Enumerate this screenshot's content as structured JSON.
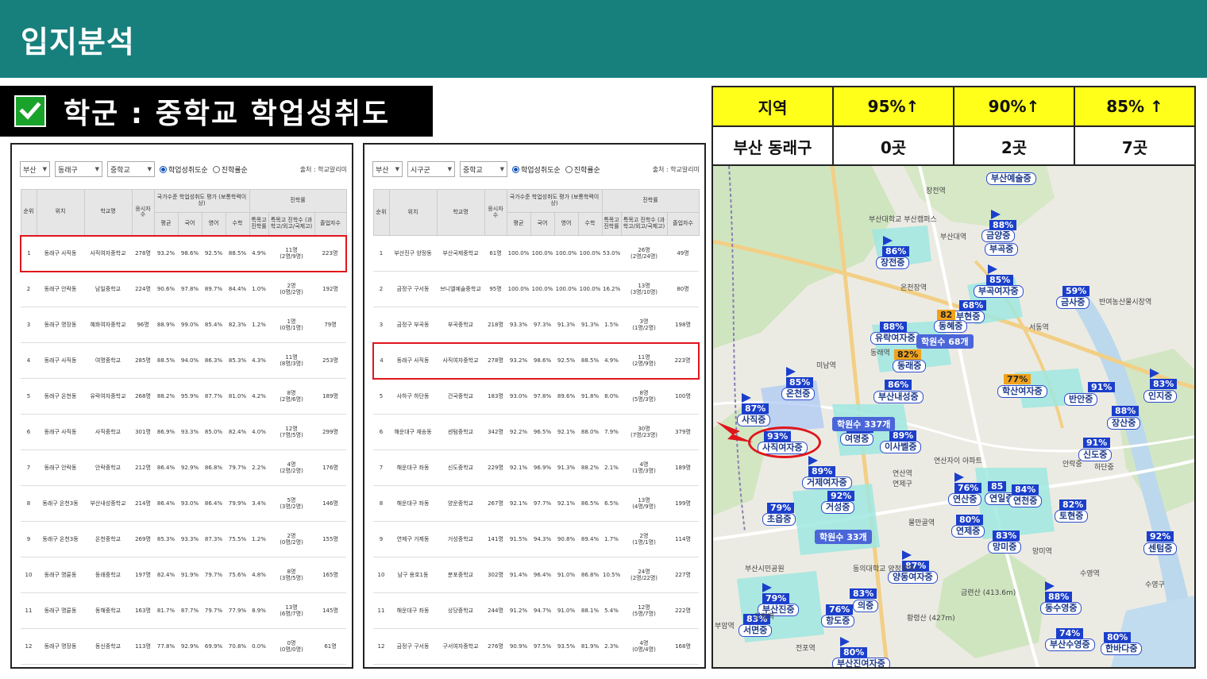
{
  "header": {
    "title": "입지분석"
  },
  "section": {
    "title": "학군 : 중학교 학업성취도"
  },
  "panel_left": {
    "filters": {
      "region": "부산",
      "district": "동래구",
      "school_type": "중학교"
    },
    "radio": {
      "achievement": "학업성취도순",
      "advancement": "진학률순"
    },
    "source": "출처 : 학교알리미",
    "headers": {
      "rank": "순위",
      "location": "위치",
      "school": "학교명",
      "test_takers": "응시자수",
      "national": "국가수준 학업성취도 평가 (보통학력이상)",
      "advancement": "진학률",
      "avg": "평균",
      "korean": "국어",
      "english": "영어",
      "math": "수학",
      "special": "특목고 진학률",
      "special_count": "특목고 진학수 (과학고/외고/국제고)",
      "graduates": "졸업자수"
    },
    "rows": [
      {
        "rank": "1",
        "loc": "동래구 사직동",
        "school": "사직여자중학교",
        "n": "278명",
        "avg": "93.2%",
        "kor": "98.6%",
        "eng": "92.5%",
        "math": "88.5%",
        "sp": "4.9%",
        "spc1": "11명",
        "spc2": "(2명/9명)",
        "grad": "223명",
        "hl": true
      },
      {
        "rank": "2",
        "loc": "동래구 안락동",
        "school": "남일중학교",
        "n": "224명",
        "avg": "90.6%",
        "kor": "97.8%",
        "eng": "89.7%",
        "math": "84.4%",
        "sp": "1.0%",
        "spc1": "2명",
        "spc2": "(0명/2명)",
        "grad": "192명",
        "hl": false
      },
      {
        "rank": "3",
        "loc": "동래구 명장동",
        "school": "혜화여자중학교",
        "n": "96명",
        "avg": "88.9%",
        "kor": "99.0%",
        "eng": "85.4%",
        "math": "82.3%",
        "sp": "1.2%",
        "spc1": "1명",
        "spc2": "(0명/1명)",
        "grad": "79명",
        "hl": false
      },
      {
        "rank": "4",
        "loc": "동래구 사직동",
        "school": "여명중학교",
        "n": "285명",
        "avg": "88.5%",
        "kor": "94.0%",
        "eng": "86.3%",
        "math": "85.3%",
        "sp": "4.3%",
        "spc1": "11명",
        "spc2": "(8명/3명)",
        "grad": "253명",
        "hl": false
      },
      {
        "rank": "5",
        "loc": "동래구 온천동",
        "school": "유락여자중학교",
        "n": "268명",
        "avg": "88.2%",
        "kor": "95.9%",
        "eng": "87.7%",
        "math": "81.0%",
        "sp": "4.2%",
        "spc1": "8명",
        "spc2": "(2명/6명)",
        "grad": "189명",
        "hl": false
      },
      {
        "rank": "6",
        "loc": "동래구 사직동",
        "school": "사직중학교",
        "n": "301명",
        "avg": "86.9%",
        "kor": "93.3%",
        "eng": "85.0%",
        "math": "82.4%",
        "sp": "4.0%",
        "spc1": "12명",
        "spc2": "(7명/5명)",
        "grad": "299명",
        "hl": false
      },
      {
        "rank": "7",
        "loc": "동래구 안락동",
        "school": "안락중학교",
        "n": "212명",
        "avg": "86.4%",
        "kor": "92.9%",
        "eng": "86.8%",
        "math": "79.7%",
        "sp": "2.2%",
        "spc1": "4명",
        "spc2": "(2명/2명)",
        "grad": "176명",
        "hl": false
      },
      {
        "rank": "8",
        "loc": "동래구 온천3동",
        "school": "부산내성중학교",
        "n": "214명",
        "avg": "86.4%",
        "kor": "93.0%",
        "eng": "86.4%",
        "math": "79.9%",
        "sp": "3.4%",
        "spc1": "5명",
        "spc2": "(3명/2명)",
        "grad": "146명",
        "hl": false
      },
      {
        "rank": "9",
        "loc": "동래구 온천3동",
        "school": "온천중학교",
        "n": "269명",
        "avg": "85.3%",
        "kor": "93.3%",
        "eng": "87.3%",
        "math": "75.5%",
        "sp": "1.2%",
        "spc1": "2명",
        "spc2": "(0명/2명)",
        "grad": "155명",
        "hl": false
      },
      {
        "rank": "10",
        "loc": "동래구 명륜동",
        "school": "동래중학교",
        "n": "197명",
        "avg": "82.4%",
        "kor": "91.9%",
        "eng": "79.7%",
        "math": "75.6%",
        "sp": "4.8%",
        "spc1": "8명",
        "spc2": "(3명/5명)",
        "grad": "165명",
        "hl": false
      },
      {
        "rank": "11",
        "loc": "동래구 명륜동",
        "school": "동해중학교",
        "n": "163명",
        "avg": "81.7%",
        "kor": "87.7%",
        "eng": "79.7%",
        "math": "77.9%",
        "sp": "8.9%",
        "spc1": "13명",
        "spc2": "(6명/7명)",
        "grad": "145명",
        "hl": false
      },
      {
        "rank": "12",
        "loc": "동래구 명장동",
        "school": "동신중학교",
        "n": "113명",
        "avg": "77.8%",
        "kor": "92.9%",
        "eng": "69.9%",
        "math": "70.8%",
        "sp": "0.0%",
        "spc1": "0명",
        "spc2": "(0명/0명)",
        "grad": "61명",
        "hl": false
      }
    ]
  },
  "panel_right": {
    "filters": {
      "region": "부산",
      "district": "시구군",
      "school_type": "중학교"
    },
    "radio": {
      "achievement": "학업성취도순",
      "advancement": "진학률순"
    },
    "source": "출처 : 학교알리미",
    "headers": {
      "rank": "순위",
      "location": "위치",
      "school": "학교명",
      "test_takers": "응시자수",
      "national": "국가수준 학업성취도 평가 (보통학력이상)",
      "advancement": "진학률",
      "avg": "평균",
      "korean": "국어",
      "english": "영어",
      "math": "수학",
      "special": "특목고 진학률",
      "special_count": "특목고 진학수 (과학고/외고/국제고)",
      "graduates": "졸업자수"
    },
    "rows": [
      {
        "rank": "1",
        "loc": "부산진구 양정동",
        "school": "부산국제중학교",
        "n": "61명",
        "avg": "100.0%",
        "kor": "100.0%",
        "eng": "100.0%",
        "math": "100.0%",
        "sp": "53.0%",
        "spc1": "26명",
        "spc2": "(2명/24명)",
        "grad": "49명",
        "hl": false
      },
      {
        "rank": "2",
        "loc": "금정구 구서동",
        "school": "브니엘예술중학교",
        "n": "95명",
        "avg": "100.0%",
        "kor": "100.0%",
        "eng": "100.0%",
        "math": "100.0%",
        "sp": "16.2%",
        "spc1": "13명",
        "spc2": "(3명/10명)",
        "grad": "80명",
        "hl": false
      },
      {
        "rank": "3",
        "loc": "금정구 부곡동",
        "school": "부곡중학교",
        "n": "218명",
        "avg": "93.3%",
        "kor": "97.3%",
        "eng": "91.3%",
        "math": "91.3%",
        "sp": "1.5%",
        "spc1": "3명",
        "spc2": "(1명/2명)",
        "grad": "198명",
        "hl": false
      },
      {
        "rank": "4",
        "loc": "동래구 사직동",
        "school": "사직여자중학교",
        "n": "278명",
        "avg": "93.2%",
        "kor": "98.6%",
        "eng": "92.5%",
        "math": "88.5%",
        "sp": "4.9%",
        "spc1": "11명",
        "spc2": "(2명/9명)",
        "grad": "223명",
        "hl": true
      },
      {
        "rank": "5",
        "loc": "사하구 하단동",
        "school": "건국중학교",
        "n": "183명",
        "avg": "93.0%",
        "kor": "97.8%",
        "eng": "89.6%",
        "math": "91.8%",
        "sp": "8.0%",
        "spc1": "8명",
        "spc2": "(5명/3명)",
        "grad": "100명",
        "hl": false
      },
      {
        "rank": "6",
        "loc": "해운대구 재송동",
        "school": "센텀중학교",
        "n": "342명",
        "avg": "92.2%",
        "kor": "96.5%",
        "eng": "92.1%",
        "math": "88.0%",
        "sp": "7.9%",
        "spc1": "30명",
        "spc2": "(7명/23명)",
        "grad": "379명",
        "hl": false
      },
      {
        "rank": "7",
        "loc": "해운대구 좌동",
        "school": "신도중학교",
        "n": "229명",
        "avg": "92.1%",
        "kor": "96.9%",
        "eng": "91.3%",
        "math": "88.2%",
        "sp": "2.1%",
        "spc1": "4명",
        "spc2": "(1명/3명)",
        "grad": "189명",
        "hl": false
      },
      {
        "rank": "8",
        "loc": "해운대구 좌동",
        "school": "양운중학교",
        "n": "267명",
        "avg": "92.1%",
        "kor": "97.7%",
        "eng": "92.1%",
        "math": "86.5%",
        "sp": "6.5%",
        "spc1": "13명",
        "spc2": "(4명/9명)",
        "grad": "199명",
        "hl": false
      },
      {
        "rank": "9",
        "loc": "연제구 거제동",
        "school": "거성중학교",
        "n": "141명",
        "avg": "91.5%",
        "kor": "94.3%",
        "eng": "90.8%",
        "math": "89.4%",
        "sp": "1.7%",
        "spc1": "2명",
        "spc2": "(1명/1명)",
        "grad": "114명",
        "hl": false
      },
      {
        "rank": "10",
        "loc": "남구 용호1동",
        "school": "분포중학교",
        "n": "302명",
        "avg": "91.4%",
        "kor": "96.4%",
        "eng": "91.0%",
        "math": "86.8%",
        "sp": "10.5%",
        "spc1": "24명",
        "spc2": "(2명/22명)",
        "grad": "227명",
        "hl": false
      },
      {
        "rank": "11",
        "loc": "해운대구 좌동",
        "school": "상당중학교",
        "n": "244명",
        "avg": "91.2%",
        "kor": "94.7%",
        "eng": "91.0%",
        "math": "88.1%",
        "sp": "5.4%",
        "spc1": "12명",
        "spc2": "(5명/7명)",
        "grad": "222명",
        "hl": false
      },
      {
        "rank": "12",
        "loc": "금정구 구서동",
        "school": "구서여자중학교",
        "n": "276명",
        "avg": "90.9%",
        "kor": "97.5%",
        "eng": "93.5%",
        "math": "81.9%",
        "sp": "2.3%",
        "spc1": "4명",
        "spc2": "(0명/4명)",
        "grad": "168명",
        "hl": false
      }
    ]
  },
  "summary": {
    "header_region": "지역",
    "h95": "95%↑",
    "h90": "90%↑",
    "h85": "85% ↑",
    "region": "부산 동래구",
    "v95": "0곳",
    "v90": "2곳",
    "v85": "7곳"
  },
  "map": {
    "pins": [
      {
        "pct": "86%",
        "name": "장전중"
      },
      {
        "pct": "88%",
        "name": "금양중"
      },
      {
        "pct": "",
        "name": "부곡중"
      },
      {
        "pct": "85%",
        "name": "부곡여자중"
      },
      {
        "pct": "59%",
        "name": "금사중"
      },
      {
        "pct": "68%",
        "name": "부현중"
      },
      {
        "pct": "82",
        "name": "동혜중"
      },
      {
        "pct": "88%",
        "name": "유락여자중"
      },
      {
        "pct": "82%",
        "name": "동래중"
      },
      {
        "pct": "85%",
        "name": "온천중"
      },
      {
        "pct": "86%",
        "name": "부산내성중"
      },
      {
        "pct": "77%",
        "name": "학산여자중"
      },
      {
        "pct": "87%",
        "name": "사직중"
      },
      {
        "pct": "93%",
        "name": "사직여자중"
      },
      {
        "pct": "89%",
        "name": "여명중"
      },
      {
        "pct": "89%",
        "name": "이사벨중"
      },
      {
        "pct": "89%",
        "name": "거제여자중"
      },
      {
        "pct": "92%",
        "name": "거성중"
      },
      {
        "pct": "79%",
        "name": "초읍중"
      },
      {
        "pct": "76%",
        "name": "연산중"
      },
      {
        "pct": "85",
        "name": "연일중"
      },
      {
        "pct": "84%",
        "name": "연천중"
      },
      {
        "pct": "80%",
        "name": "연제중"
      },
      {
        "pct": "83%",
        "name": "망미중"
      },
      {
        "pct": "82%",
        "name": "토현중"
      },
      {
        "pct": "91%",
        "name": "반안중"
      },
      {
        "pct": "83%",
        "name": "인지중"
      },
      {
        "pct": "88%",
        "name": "장산중"
      },
      {
        "pct": "91%",
        "name": "신도중"
      },
      {
        "pct": "92%",
        "name": "센텀중"
      },
      {
        "pct": "87%",
        "name": "양동여자중"
      },
      {
        "pct": "83%",
        "name": "의중"
      },
      {
        "pct": "76%",
        "name": "항도중"
      },
      {
        "pct": "79%",
        "name": "부산진중"
      },
      {
        "pct": "83%",
        "name": "서면중"
      },
      {
        "pct": "88%",
        "name": "동수영중"
      },
      {
        "pct": "74%",
        "name": "부산수영중"
      },
      {
        "pct": "80%",
        "name": "한바다중"
      },
      {
        "pct": "80%",
        "name": "부산진여자중"
      },
      {
        "pct": "",
        "name": "부산예술중"
      }
    ],
    "places": [
      "장전역",
      "부산대학교 부산캠퍼스",
      "부산대역",
      "온천장역",
      "서동역",
      "미남역",
      "동래역",
      "연산자이 아파트",
      "연산역",
      "연제구",
      "금련산 (413.6m)",
      "황령산 (427m)",
      "수영역",
      "부산시민공원",
      "동의대학교 양정캠퍼스",
      "물만골역",
      "망미역",
      "전포역",
      "부암역",
      "수영구",
      "반여농산물시장역",
      "양정역",
      "안락중",
      "하단중"
    ],
    "counts": [
      "학원수 68개",
      "학원수 337개",
      "학원수 33개"
    ]
  }
}
